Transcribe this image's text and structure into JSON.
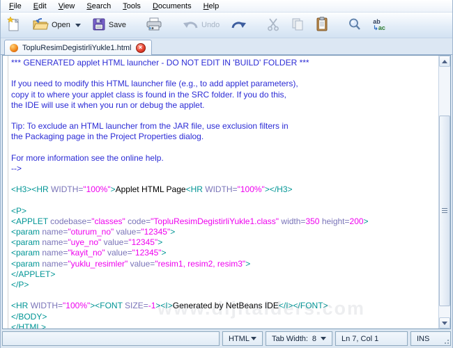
{
  "menu_bar": {
    "items": [
      {
        "label": "File"
      },
      {
        "label": "Edit"
      },
      {
        "label": "View"
      },
      {
        "label": "Search"
      },
      {
        "label": "Tools"
      },
      {
        "label": "Documents"
      },
      {
        "label": "Help"
      }
    ]
  },
  "toolbar": {
    "open_label": "Open",
    "save_label": "Save",
    "undo_label": "Undo",
    "replace_top": "ab",
    "replace_bottom": "ac",
    "replace_arrow": "↳"
  },
  "tab_bar": {
    "active_tab": {
      "title": "TopluResimDegistirliYukle1.html",
      "close_glyph": "×"
    }
  },
  "editor": {
    "lines": [
      [
        [
          "c",
          "*** GENERATED applet HTML launcher - DO NOT EDIT IN 'BUILD' FOLDER ***"
        ]
      ],
      [],
      [
        [
          "c",
          "If you need to modify this HTML launcher file (e.g., to add applet parameters),"
        ]
      ],
      [
        [
          "c",
          "copy it to where your applet class is found in the SRC folder. If you do this,"
        ]
      ],
      [
        [
          "c",
          "the IDE will use it when you run or debug the applet."
        ]
      ],
      [],
      [
        [
          "c",
          "Tip: To exclude an HTML launcher from the JAR file, use exclusion filters in"
        ]
      ],
      [
        [
          "c",
          "the Packaging page in the Project Properties dialog."
        ]
      ],
      [],
      [
        [
          "c",
          "For more information see the online help."
        ]
      ],
      [
        [
          "c",
          "-->"
        ]
      ],
      [],
      [
        [
          "g",
          "<H3><HR "
        ],
        [
          "a",
          "WIDTH="
        ],
        [
          "v",
          "\"100%\""
        ],
        [
          "g",
          ">"
        ],
        [
          "p",
          "Applet HTML Page"
        ],
        [
          "g",
          "<HR "
        ],
        [
          "a",
          "WIDTH="
        ],
        [
          "v",
          "\"100%\""
        ],
        [
          "g",
          "></H3>"
        ]
      ],
      [],
      [
        [
          "g",
          "<P>"
        ]
      ],
      [
        [
          "g",
          "<APPLET "
        ],
        [
          "a",
          "codebase="
        ],
        [
          "v",
          "\"classes\""
        ],
        [
          "p",
          " "
        ],
        [
          "a",
          "code="
        ],
        [
          "v",
          "\"TopluResimDegistirliYukle1.class\""
        ],
        [
          "p",
          " "
        ],
        [
          "a",
          "width="
        ],
        [
          "v",
          "350"
        ],
        [
          "p",
          " "
        ],
        [
          "a",
          "height="
        ],
        [
          "v",
          "200"
        ],
        [
          "g",
          ">"
        ]
      ],
      [
        [
          "g",
          "<param "
        ],
        [
          "a",
          "name="
        ],
        [
          "v",
          "\"oturum_no\""
        ],
        [
          "p",
          " "
        ],
        [
          "a",
          "value="
        ],
        [
          "v",
          "\"12345\""
        ],
        [
          "g",
          ">"
        ]
      ],
      [
        [
          "g",
          "<param "
        ],
        [
          "a",
          "name="
        ],
        [
          "v",
          "\"uye_no\""
        ],
        [
          "p",
          " "
        ],
        [
          "a",
          "value="
        ],
        [
          "v",
          "\"12345\""
        ],
        [
          "g",
          ">"
        ]
      ],
      [
        [
          "g",
          "<param "
        ],
        [
          "a",
          "name="
        ],
        [
          "v",
          "\"kayit_no\""
        ],
        [
          "p",
          " "
        ],
        [
          "a",
          "value="
        ],
        [
          "v",
          "\"12345\""
        ],
        [
          "g",
          ">"
        ]
      ],
      [
        [
          "g",
          "<param "
        ],
        [
          "a",
          "name="
        ],
        [
          "v",
          "\"yuklu_resimler\""
        ],
        [
          "p",
          " "
        ],
        [
          "a",
          "value="
        ],
        [
          "v",
          "\"resim1, resim2, resim3\""
        ],
        [
          "g",
          ">"
        ]
      ],
      [
        [
          "g",
          "</APPLET>"
        ]
      ],
      [
        [
          "g",
          "</P>"
        ]
      ],
      [],
      [
        [
          "g",
          "<HR "
        ],
        [
          "a",
          "WIDTH="
        ],
        [
          "v",
          "\"100%\""
        ],
        [
          "g",
          "><FONT "
        ],
        [
          "a",
          "SIZE="
        ],
        [
          "v",
          "-1"
        ],
        [
          "g",
          "><I>"
        ],
        [
          "p",
          "Generated by NetBeans IDE"
        ],
        [
          "g",
          "</I></FONT>"
        ]
      ],
      [
        [
          "g",
          "</BODY>"
        ]
      ],
      [
        [
          "g",
          "</HTML>"
        ]
      ]
    ]
  },
  "watermark": "www.dijitalders.com",
  "status_bar": {
    "message": "",
    "mode": "HTML",
    "tab_width_label": "Tab Width:",
    "tab_width_value": "8",
    "position": "Ln 7, Col 1",
    "insert_mode": "INS"
  },
  "colors": {
    "comment": "#2b2bd5",
    "tag": "#009595",
    "attr": "#7a74b8",
    "value": "#ee00ee",
    "plain": "#000000",
    "accent": "#7f9db9"
  }
}
